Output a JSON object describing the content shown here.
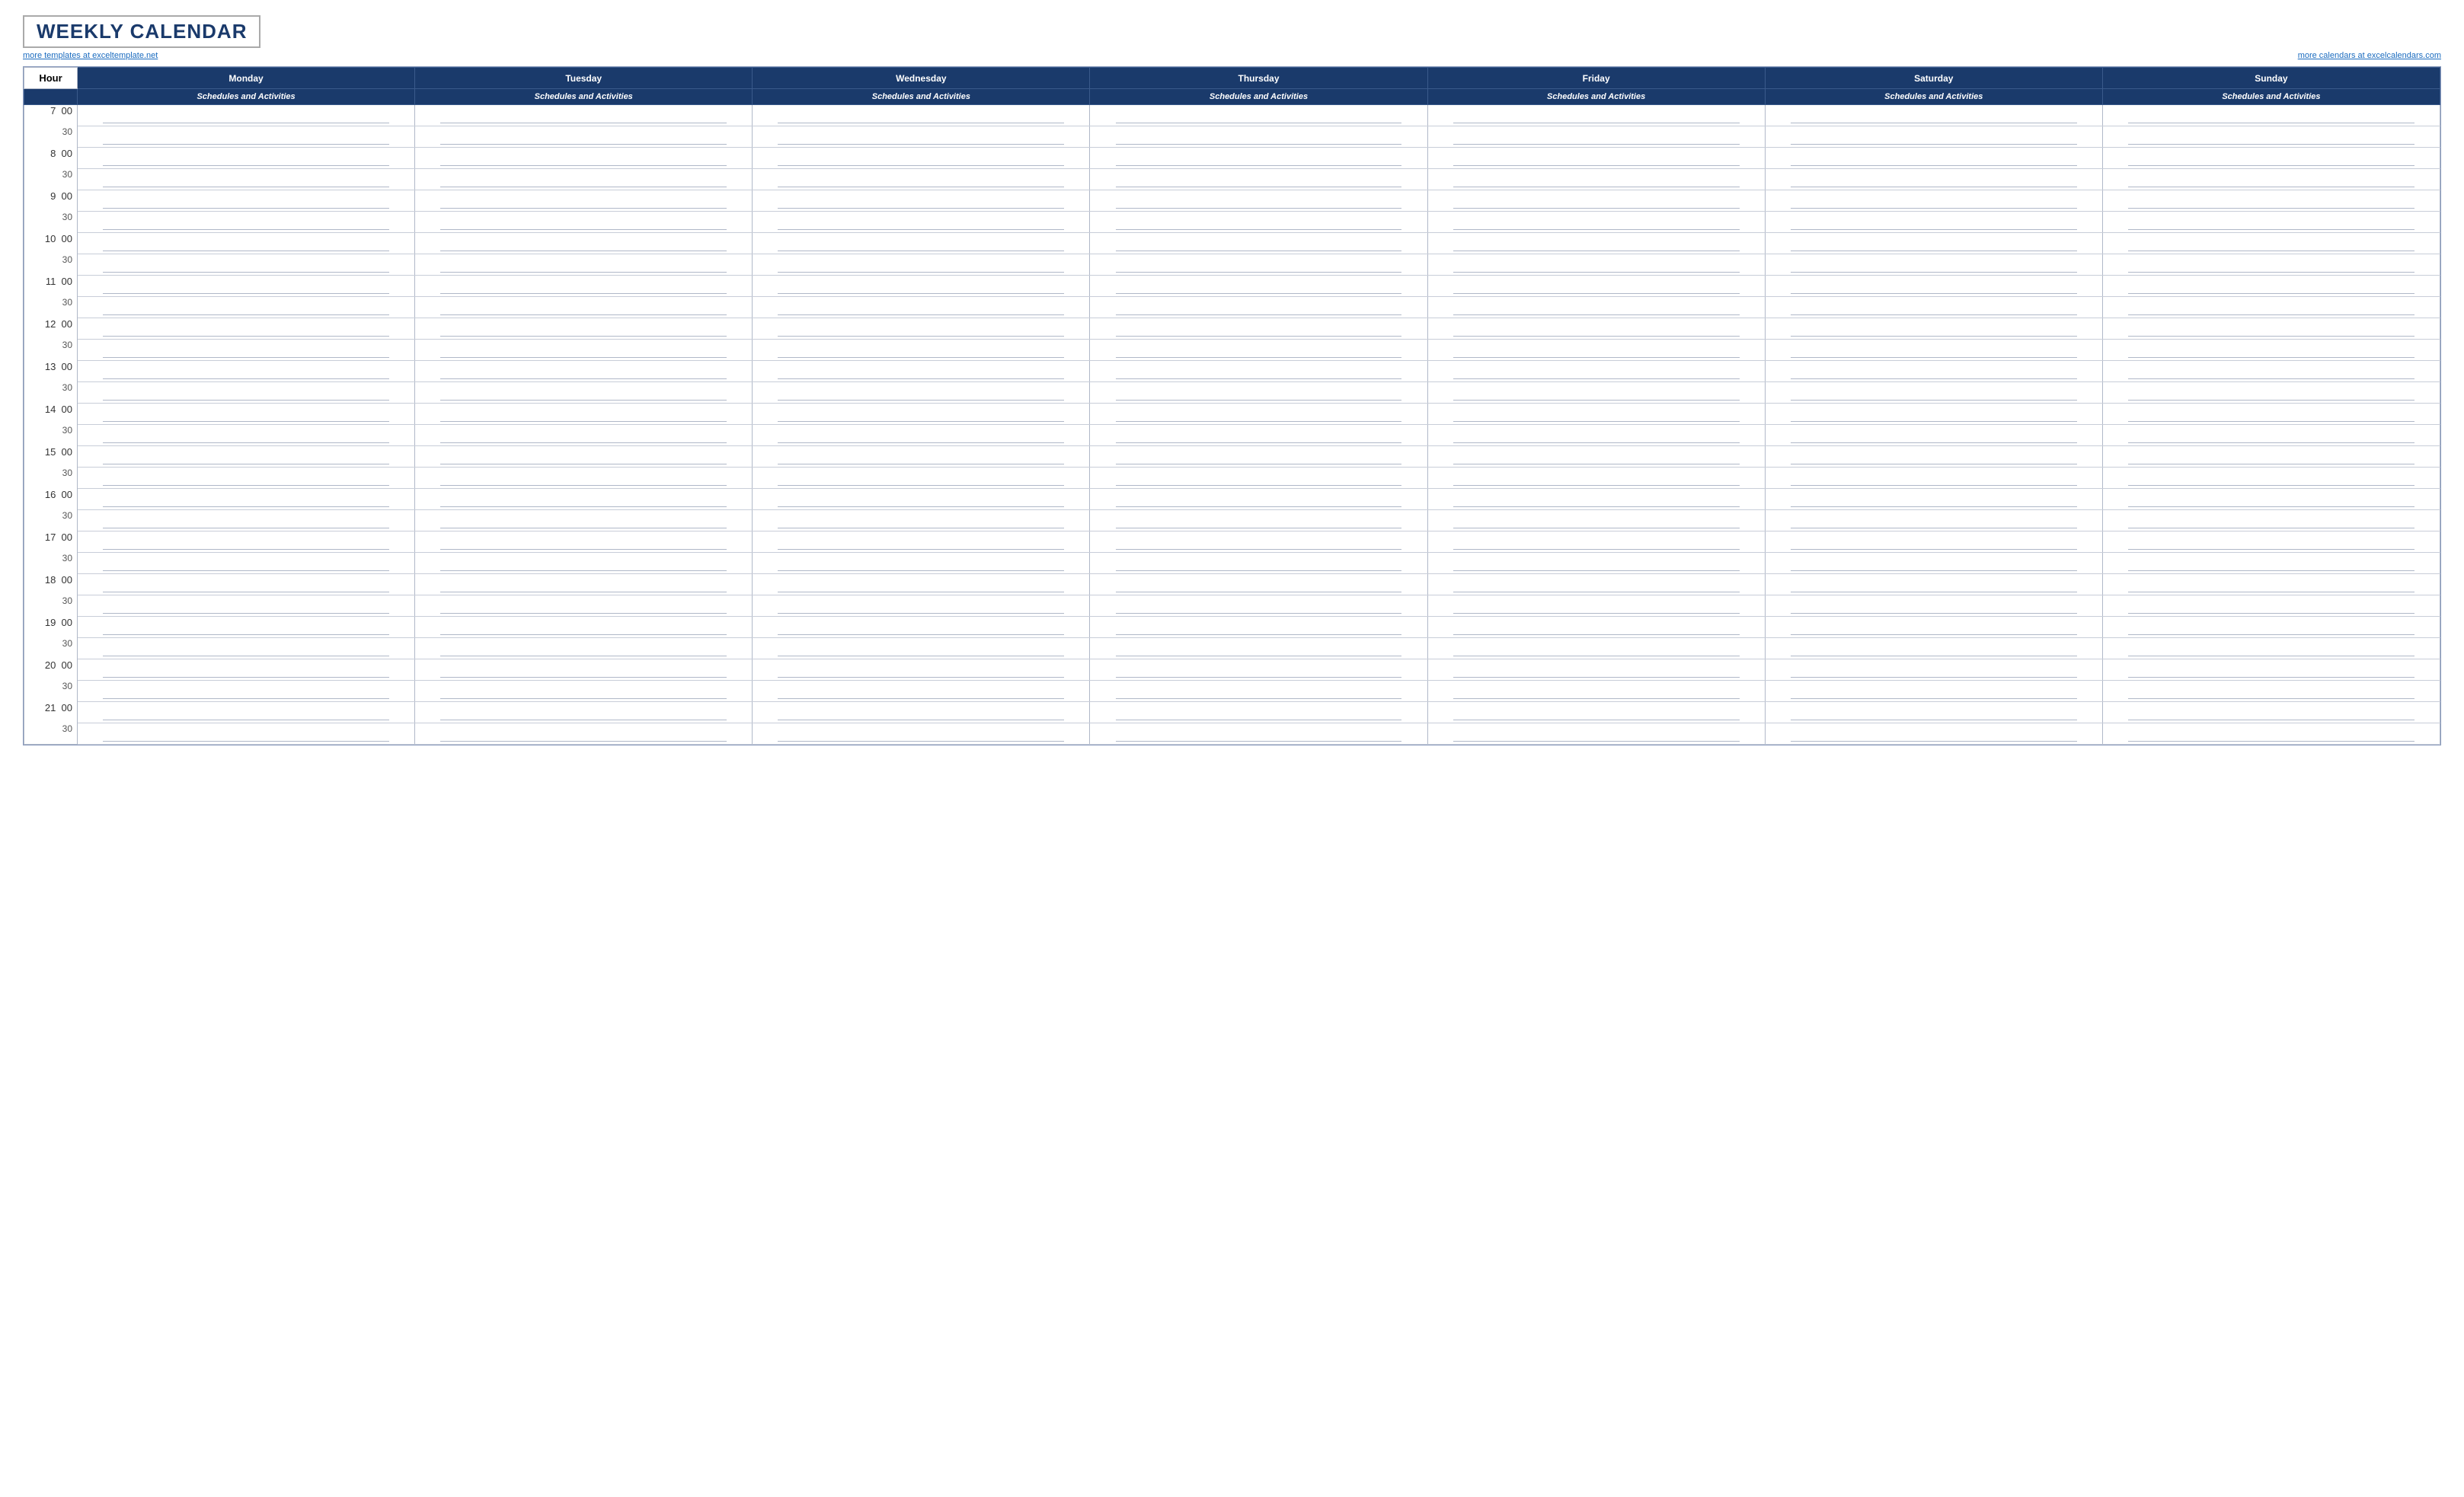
{
  "title": "WEEKLY CALENDAR",
  "links": {
    "left": "more templates at exceltemplate.net",
    "right": "more calendars at excelcalendars.com"
  },
  "columns": {
    "hour": "Hour",
    "days": [
      "Monday",
      "Tuesday",
      "Wednesday",
      "Thursday",
      "Friday",
      "Saturday",
      "Sunday"
    ]
  },
  "subheader": "Schedules and Activities",
  "hours": [
    {
      "main": "7",
      "sub": "00",
      "half": "30"
    },
    {
      "main": "8",
      "sub": "00",
      "half": "30"
    },
    {
      "main": "9",
      "sub": "00",
      "half": "30"
    },
    {
      "main": "10",
      "sub": "00",
      "half": "30"
    },
    {
      "main": "11",
      "sub": "00",
      "half": "30"
    },
    {
      "main": "12",
      "sub": "00",
      "half": "30"
    },
    {
      "main": "13",
      "sub": "00",
      "half": "30"
    },
    {
      "main": "14",
      "sub": "00",
      "half": "30"
    },
    {
      "main": "15",
      "sub": "00",
      "half": "30"
    },
    {
      "main": "16",
      "sub": "00",
      "half": "30"
    },
    {
      "main": "17",
      "sub": "00",
      "half": "30"
    },
    {
      "main": "18",
      "sub": "00",
      "half": "30"
    },
    {
      "main": "19",
      "sub": "00",
      "half": "30"
    },
    {
      "main": "20",
      "sub": "00",
      "half": "30"
    },
    {
      "main": "21",
      "sub": "00",
      "half": "30"
    }
  ],
  "colors": {
    "header_bg": "#1a3a6b",
    "border": "#b0b8c8",
    "link": "#1a6bbf",
    "title": "#1a3a6b"
  }
}
